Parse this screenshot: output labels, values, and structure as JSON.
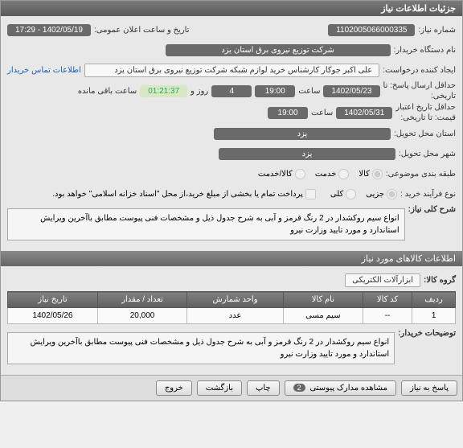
{
  "header": {
    "title": "جزئیات اطلاعات نیاز"
  },
  "fields": {
    "need_number_label": "شماره نیاز:",
    "need_number": "1102005066000335",
    "public_datetime_label": "تاریخ و ساعت اعلان عمومی:",
    "public_datetime": "1402/05/19 - 17:29",
    "buyer_org_label": "نام دستگاه خریدار:",
    "buyer_org": "شرکت توزیع نیروی برق استان یزد",
    "requester_label": "ایجاد کننده درخواست:",
    "requester": "علی اکبر جوکار  کارشناس خرید لوازم شبکه  شرکت توزیع نیروی برق استان یزد",
    "contact_link": "اطلاعات تماس خریدار",
    "deadline_label1": "حداقل ارسال پاسخ: تا",
    "deadline_label2": "تاریخی:",
    "deadline_date": "1402/05/23",
    "deadline_time_label": "ساعت",
    "deadline_time": "19:00",
    "day_label": "روز و",
    "day_val": "4",
    "remain_label": "ساعت باقی مانده",
    "remain_time": "01:21:37",
    "price_deadline_label1": "حداقل تاریخ اعتبار",
    "price_deadline_label2": "قیمت: تا تاریخی:",
    "price_date": "1402/05/31",
    "price_time": "19:00",
    "delivery_city_label": "استان محل تحویل:",
    "delivery_city": "یزد",
    "delivery_town_label": "شهر محل تحویل:",
    "delivery_town": "یزد",
    "cat_label": "طبقه بندی موضوعی:",
    "opt_goods": "کالا",
    "opt_service": "خدمت",
    "opt_both": "کالا/خدمت",
    "process_label": "نوع فرآیند خرید :",
    "opt_partial": "جزیی",
    "opt_full": "کلی",
    "payment_note": "پرداخت تمام یا بخشی از مبلغ خرید،از محل \"اسناد خزانه اسلامی\" خواهد بود.",
    "desc_label": "شرح کلی نیاز:",
    "desc_text": "انواع سیم روکشدار در 2 رنگ قرمز و آبی به شرح جدول ذیل و مشخصات فنی  پیوست مطابق باآخرین ویرایش استاندارد و مورد تایید وزارت نیرو"
  },
  "items_section": {
    "title": "اطلاعات کالاهای مورد نیاز",
    "group_label": "گروه کالا:",
    "group_value": "ابزارآلات الکتریکی"
  },
  "table": {
    "headers": {
      "row": "ردیف",
      "code": "کد کالا",
      "name": "نام کالا",
      "unit": "واحد شمارش",
      "qty": "تعداد / مقدار",
      "date": "تاریخ نیاز"
    },
    "rows": [
      {
        "row": "1",
        "code": "--",
        "name": "سیم مسی",
        "unit": "عدد",
        "qty": "20,000",
        "date": "1402/05/26"
      }
    ]
  },
  "buyer_notes": {
    "label": "توضیحات خریدار:",
    "text": "انواع سیم روکشدار در 2 رنگ قرمز و آبی به شرح جدول ذیل و مشخصات فنی  پیوست مطابق باآخرین ویرایش استاندارد و مورد تایید وزارت نیرو"
  },
  "buttons": {
    "reply": "پاسخ به نیاز",
    "attachments": "مشاهده مدارک پیوستی",
    "attachments_count": "2",
    "print": "چاپ",
    "back": "بازگشت",
    "exit": "خروج"
  }
}
